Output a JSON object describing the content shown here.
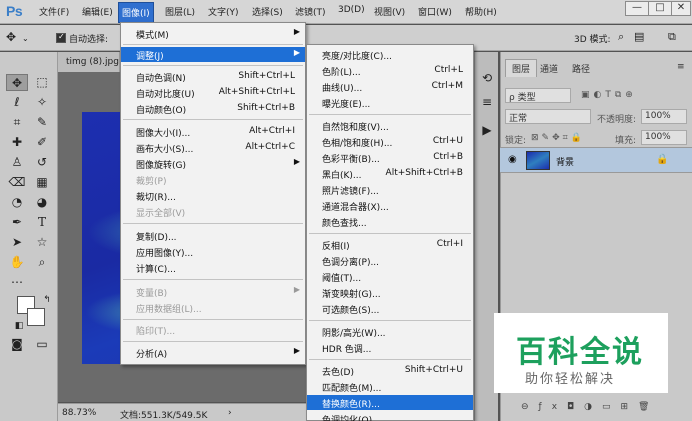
{
  "app": {
    "logo": "Ps"
  },
  "menubar": {
    "items": [
      "文件(F)",
      "编辑(E)",
      "图像(I)",
      "图层(L)",
      "文字(Y)",
      "选择(S)",
      "滤镜(T)",
      "3D(D)",
      "视图(V)",
      "窗口(W)",
      "帮助(H)"
    ],
    "active_index": 2
  },
  "window_buttons": {
    "minimize": "—",
    "restore": "□",
    "close": "✕"
  },
  "options_bar": {
    "move_icon": "move-icon",
    "auto_select_label": "自动选择:",
    "mode_3d_label": "3D 模式:",
    "auto_select_checked": true
  },
  "document": {
    "tab_title": "timg (8).jpg",
    "zoom": "88.73%",
    "doc_info": "文档:551.3K/549.5K"
  },
  "image_menu": {
    "items": [
      {
        "label": "模式(M)",
        "submenu": true
      },
      {
        "label": "调整(J)",
        "submenu": true,
        "highlighted": true
      },
      {
        "label": "自动色调(N)",
        "shortcut": "Shift+Ctrl+L"
      },
      {
        "label": "自动对比度(U)",
        "shortcut": "Alt+Shift+Ctrl+L"
      },
      {
        "label": "自动颜色(O)",
        "shortcut": "Shift+Ctrl+B"
      },
      {
        "label": "图像大小(I)...",
        "shortcut": "Alt+Ctrl+I"
      },
      {
        "label": "画布大小(S)...",
        "shortcut": "Alt+Ctrl+C"
      },
      {
        "label": "图像旋转(G)",
        "submenu": true
      },
      {
        "label": "裁剪(P)",
        "disabled": true
      },
      {
        "label": "裁切(R)..."
      },
      {
        "label": "显示全部(V)",
        "disabled": true
      },
      {
        "label": "复制(D)..."
      },
      {
        "label": "应用图像(Y)..."
      },
      {
        "label": "计算(C)..."
      },
      {
        "label": "变量(B)",
        "submenu": true,
        "disabled": true
      },
      {
        "label": "应用数据组(L)...",
        "disabled": true
      },
      {
        "label": "陷印(T)...",
        "disabled": true
      },
      {
        "label": "分析(A)",
        "submenu": true
      }
    ]
  },
  "adjust_menu": {
    "items": [
      {
        "label": "亮度/对比度(C)..."
      },
      {
        "label": "色阶(L)...",
        "shortcut": "Ctrl+L"
      },
      {
        "label": "曲线(U)...",
        "shortcut": "Ctrl+M"
      },
      {
        "label": "曝光度(E)..."
      },
      {
        "label": "自然饱和度(V)..."
      },
      {
        "label": "色相/饱和度(H)...",
        "shortcut": "Ctrl+U"
      },
      {
        "label": "色彩平衡(B)...",
        "shortcut": "Ctrl+B"
      },
      {
        "label": "黑白(K)...",
        "shortcut": "Alt+Shift+Ctrl+B"
      },
      {
        "label": "照片滤镜(F)..."
      },
      {
        "label": "通道混合器(X)..."
      },
      {
        "label": "颜色查找..."
      },
      {
        "label": "反相(I)",
        "shortcut": "Ctrl+I"
      },
      {
        "label": "色调分离(P)..."
      },
      {
        "label": "阈值(T)..."
      },
      {
        "label": "渐变映射(G)..."
      },
      {
        "label": "可选颜色(S)..."
      },
      {
        "label": "阴影/高光(W)..."
      },
      {
        "label": "HDR 色调..."
      },
      {
        "label": "去色(D)",
        "shortcut": "Shift+Ctrl+U"
      },
      {
        "label": "匹配颜色(M)..."
      },
      {
        "label": "替换颜色(R)...",
        "highlighted": true
      },
      {
        "label": "色调均化(Q)"
      }
    ]
  },
  "layers_panel": {
    "tabs": [
      "图层",
      "通道",
      "路径"
    ],
    "active_tab": 0,
    "filter_kind": "ρ 类型",
    "blend_mode": "正常",
    "opacity_label": "不透明度:",
    "opacity_value": "100%",
    "lock_label": "锁定:",
    "fill_label": "填充:",
    "fill_value": "100%",
    "layer_name": "背景"
  },
  "watermark": {
    "title": "百科全说",
    "subtitle": "助你轻松解决"
  },
  "colors": {
    "menu_highlight": "#1e6fd6",
    "active_menu": "#2f6fcf",
    "watermark_green": "#1da05d"
  }
}
